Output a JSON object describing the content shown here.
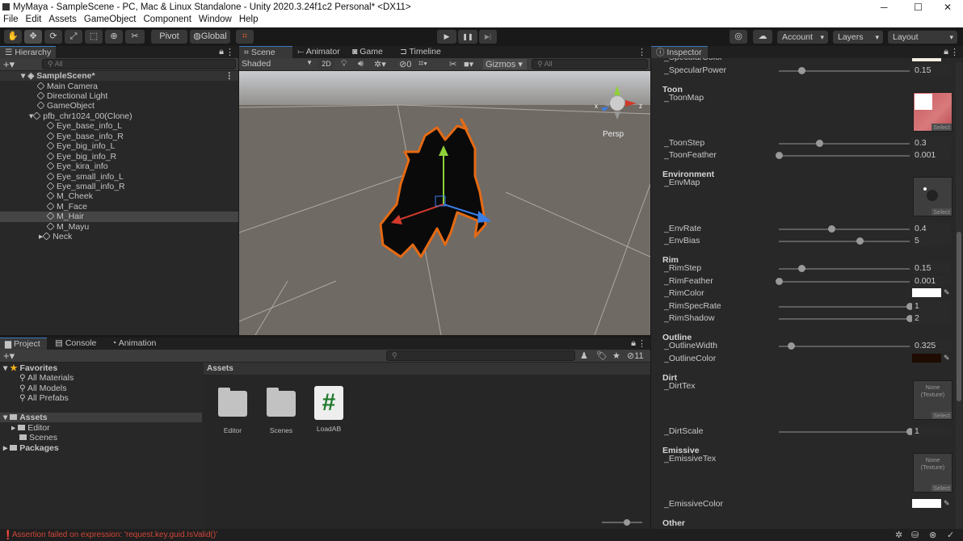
{
  "window": {
    "title": "MyMaya - SampleScene - PC, Mac & Linux Standalone - Unity 2020.3.24f1c2 Personal* <DX11>",
    "min": "─",
    "max": "☐",
    "close": "✕"
  },
  "menu": [
    "File",
    "Edit",
    "Assets",
    "GameObject",
    "Component",
    "Window",
    "Help"
  ],
  "toolbar": {
    "pivot": "Pivot",
    "global": "Global",
    "account": "Account",
    "layers": "Layers",
    "layout": "Layout",
    "play": "▶",
    "pause": "❚❚",
    "step": "▶|"
  },
  "hierarchy": {
    "tab": "Hierarchy",
    "search_placeholder": "All",
    "scene": "SampleScene*",
    "items": [
      "Main Camera",
      "Directional Light",
      "GameObject",
      "pfb_chr1024_00(Clone)",
      "Eye_base_info_L",
      "Eye_base_info_R",
      "Eye_big_info_L",
      "Eye_big_info_R",
      "Eye_kira_info",
      "Eye_small_info_L",
      "Eye_small_info_R",
      "M_Cheek",
      "M_Face",
      "M_Hair",
      "M_Mayu",
      "Neck"
    ],
    "selected": "M_Hair"
  },
  "scene": {
    "tabs": [
      "Scene",
      "Animator",
      "Game",
      "Timeline"
    ],
    "shading": "Shaded",
    "mode2d": "2D",
    "hidden_count": "0",
    "gizmos": "Gizmos",
    "search_placeholder": "All",
    "persp": "Persp"
  },
  "inspector": {
    "tab": "Inspector",
    "groups": {
      "toon": "Toon",
      "environment": "Environment",
      "rim": "Rim",
      "outline": "Outline",
      "dirt": "Dirt",
      "emissive": "Emissive",
      "other": "Other"
    },
    "props": {
      "specular_color": {
        "label": "_SpecularColor",
        "color": "#f5efe0"
      },
      "specular_power": {
        "label": "_SpecularPower",
        "value": "0.15",
        "fraction": 0.17
      },
      "toon_map": {
        "label": "_ToonMap",
        "select": "Select"
      },
      "toon_step": {
        "label": "_ToonStep",
        "value": "0.3",
        "fraction": 0.31
      },
      "toon_feather": {
        "label": "_ToonFeather",
        "value": "0.001",
        "fraction": 0
      },
      "env_map": {
        "label": "_EnvMap",
        "select": "Select"
      },
      "env_rate": {
        "label": "_EnvRate",
        "value": "0.4",
        "fraction": 0.4
      },
      "env_bias": {
        "label": "_EnvBias",
        "value": "5",
        "fraction": 0.62
      },
      "rim_step": {
        "label": "_RimStep",
        "value": "0.15",
        "fraction": 0.17
      },
      "rim_feather": {
        "label": "_RimFeather",
        "value": "0.001",
        "fraction": 0
      },
      "rim_color": {
        "label": "_RimColor",
        "color": "#ffffff"
      },
      "rim_spec_rate": {
        "label": "_RimSpecRate",
        "value": "1",
        "fraction": 1
      },
      "rim_shadow": {
        "label": "_RimShadow",
        "value": "2",
        "fraction": 1
      },
      "outline_width": {
        "label": "_OutlineWidth",
        "value": "0.325",
        "fraction": 0.09
      },
      "outline_color": {
        "label": "_OutlineColor",
        "color": "#1e0b02"
      },
      "dirt_tex": {
        "label": "_DirtTex",
        "none": "None",
        "type": "(Texture)",
        "select": "Select"
      },
      "dirt_scale": {
        "label": "_DirtScale",
        "value": "1",
        "fraction": 1
      },
      "emissive_tex": {
        "label": "_EmissiveTex",
        "none": "None",
        "type": "(Texture)",
        "select": "Select"
      },
      "emissive_color": {
        "label": "_EmissiveColor",
        "color": "#ffffff"
      }
    }
  },
  "project": {
    "tabs": [
      "Project",
      "Console",
      "Animation"
    ],
    "hidden_count": "11",
    "favorites": "Favorites",
    "fav_items": [
      "All Materials",
      "All Models",
      "All Prefabs"
    ],
    "assets": "Assets",
    "asset_folders": [
      "Editor",
      "Scenes"
    ],
    "packages": "Packages",
    "breadcrumb": "Assets",
    "grid": [
      "Editor",
      "Scenes",
      "LoadAB"
    ]
  },
  "status": {
    "error": "Assertion failed on expression: 'request.key.guid.IsValid()'"
  }
}
